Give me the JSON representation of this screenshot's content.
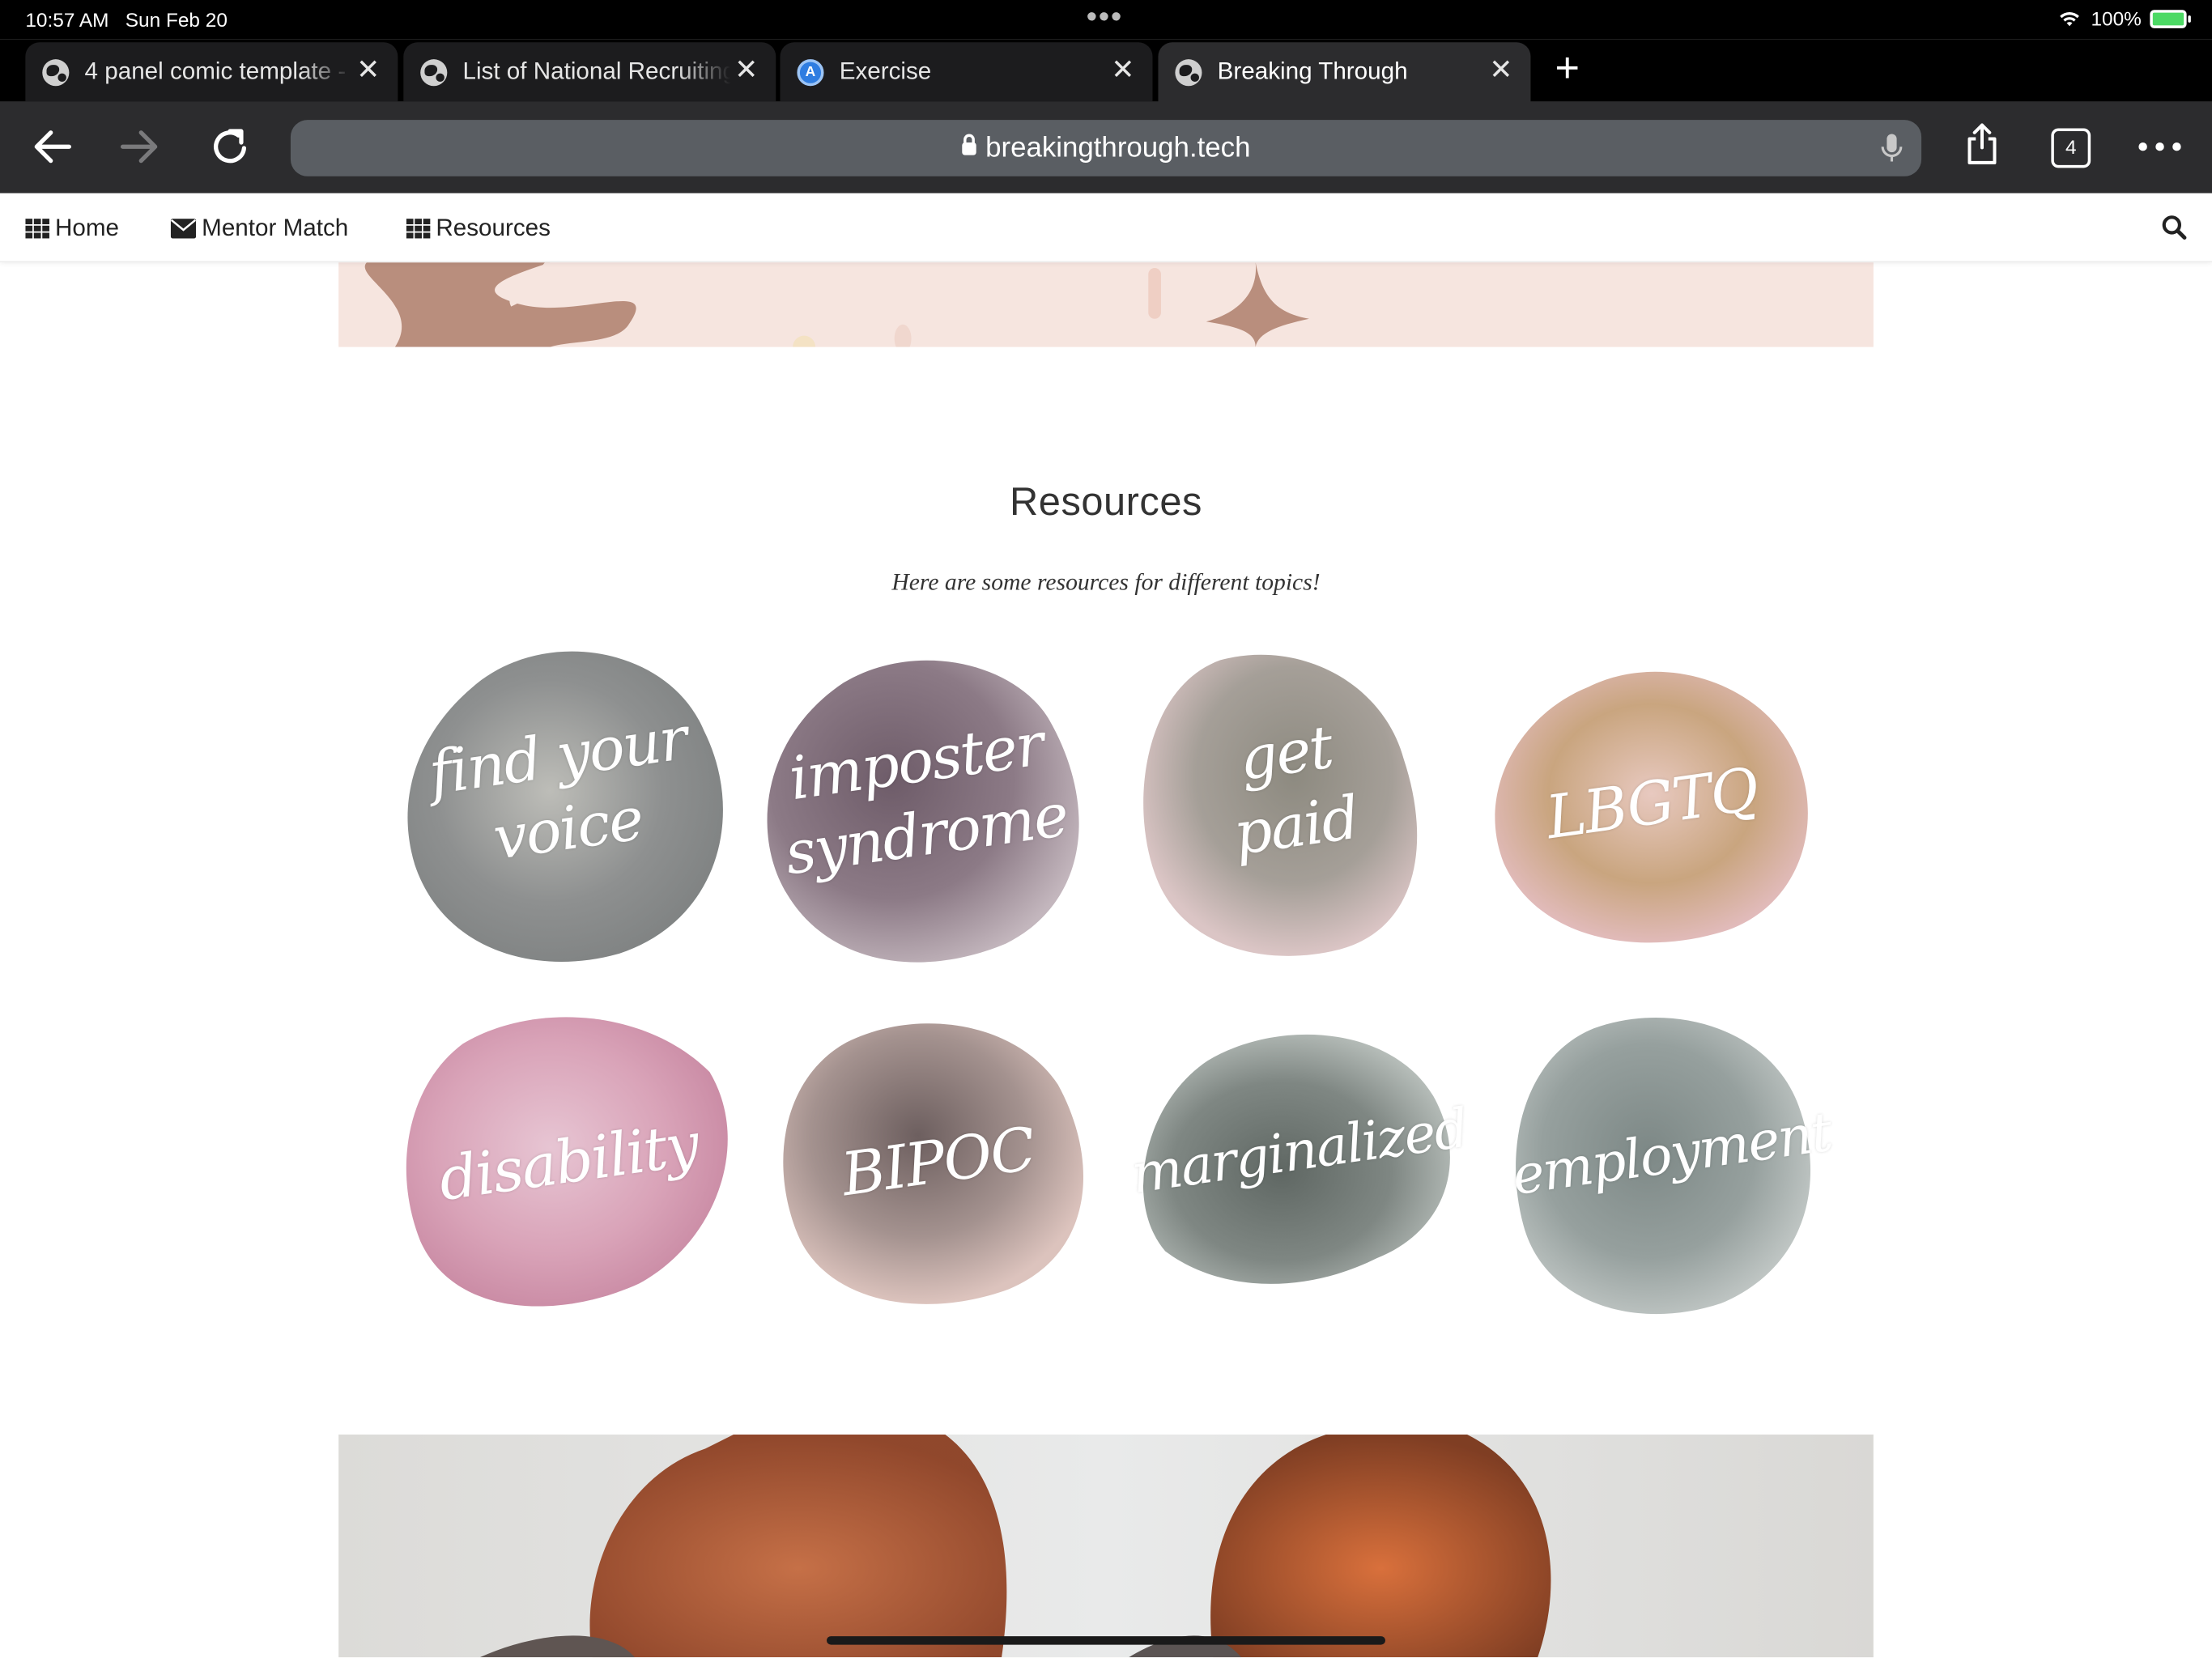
{
  "status_bar": {
    "time": "10:57 AM",
    "date": "Sun Feb 20",
    "battery_percent": "100%",
    "battery_level": 1.0
  },
  "tabs": [
    {
      "title": "4 panel comic template -",
      "favicon": "globe-icon",
      "active": false
    },
    {
      "title": "List of National Recruiting",
      "favicon": "globe-icon",
      "active": false
    },
    {
      "title": "Exercise",
      "favicon": "app-store-icon",
      "active": false
    },
    {
      "title": "Breaking Through",
      "favicon": "globe-icon",
      "active": true
    }
  ],
  "toolbar": {
    "url": "breakingthrough.tech",
    "tab_count": "4"
  },
  "site_nav": {
    "items": [
      {
        "label": "Home",
        "icon": "grid-icon"
      },
      {
        "label": "Mentor Match",
        "icon": "envelope-icon"
      },
      {
        "label": "Resources",
        "icon": "grid-icon"
      }
    ]
  },
  "resources": {
    "title": "Resources",
    "subtitle": "Here are some resources for different topics!",
    "topics": [
      {
        "lines": [
          "find your",
          "voice"
        ],
        "color": "#8e9090"
      },
      {
        "lines": [
          "imposter",
          "syndrome"
        ],
        "color": "#8c7a86"
      },
      {
        "lines": [
          "get",
          "paid"
        ],
        "color": "#a59f98"
      },
      {
        "lines": [
          "LBGTQ"
        ],
        "color": "#c9a57f"
      },
      {
        "lines": [
          "disability"
        ],
        "color": "#d9a3b8"
      },
      {
        "lines": [
          "BIPOC"
        ],
        "color": "#a4928f"
      },
      {
        "lines": [
          "marginalized"
        ],
        "color": "#7f8783"
      },
      {
        "lines": [
          "employment"
        ],
        "color": "#96a09e"
      }
    ]
  },
  "colors": {
    "hero_top_bg": "#f6e5df",
    "hero_bottom_bg": "#e6e4e1",
    "hair": "#b4572e"
  }
}
